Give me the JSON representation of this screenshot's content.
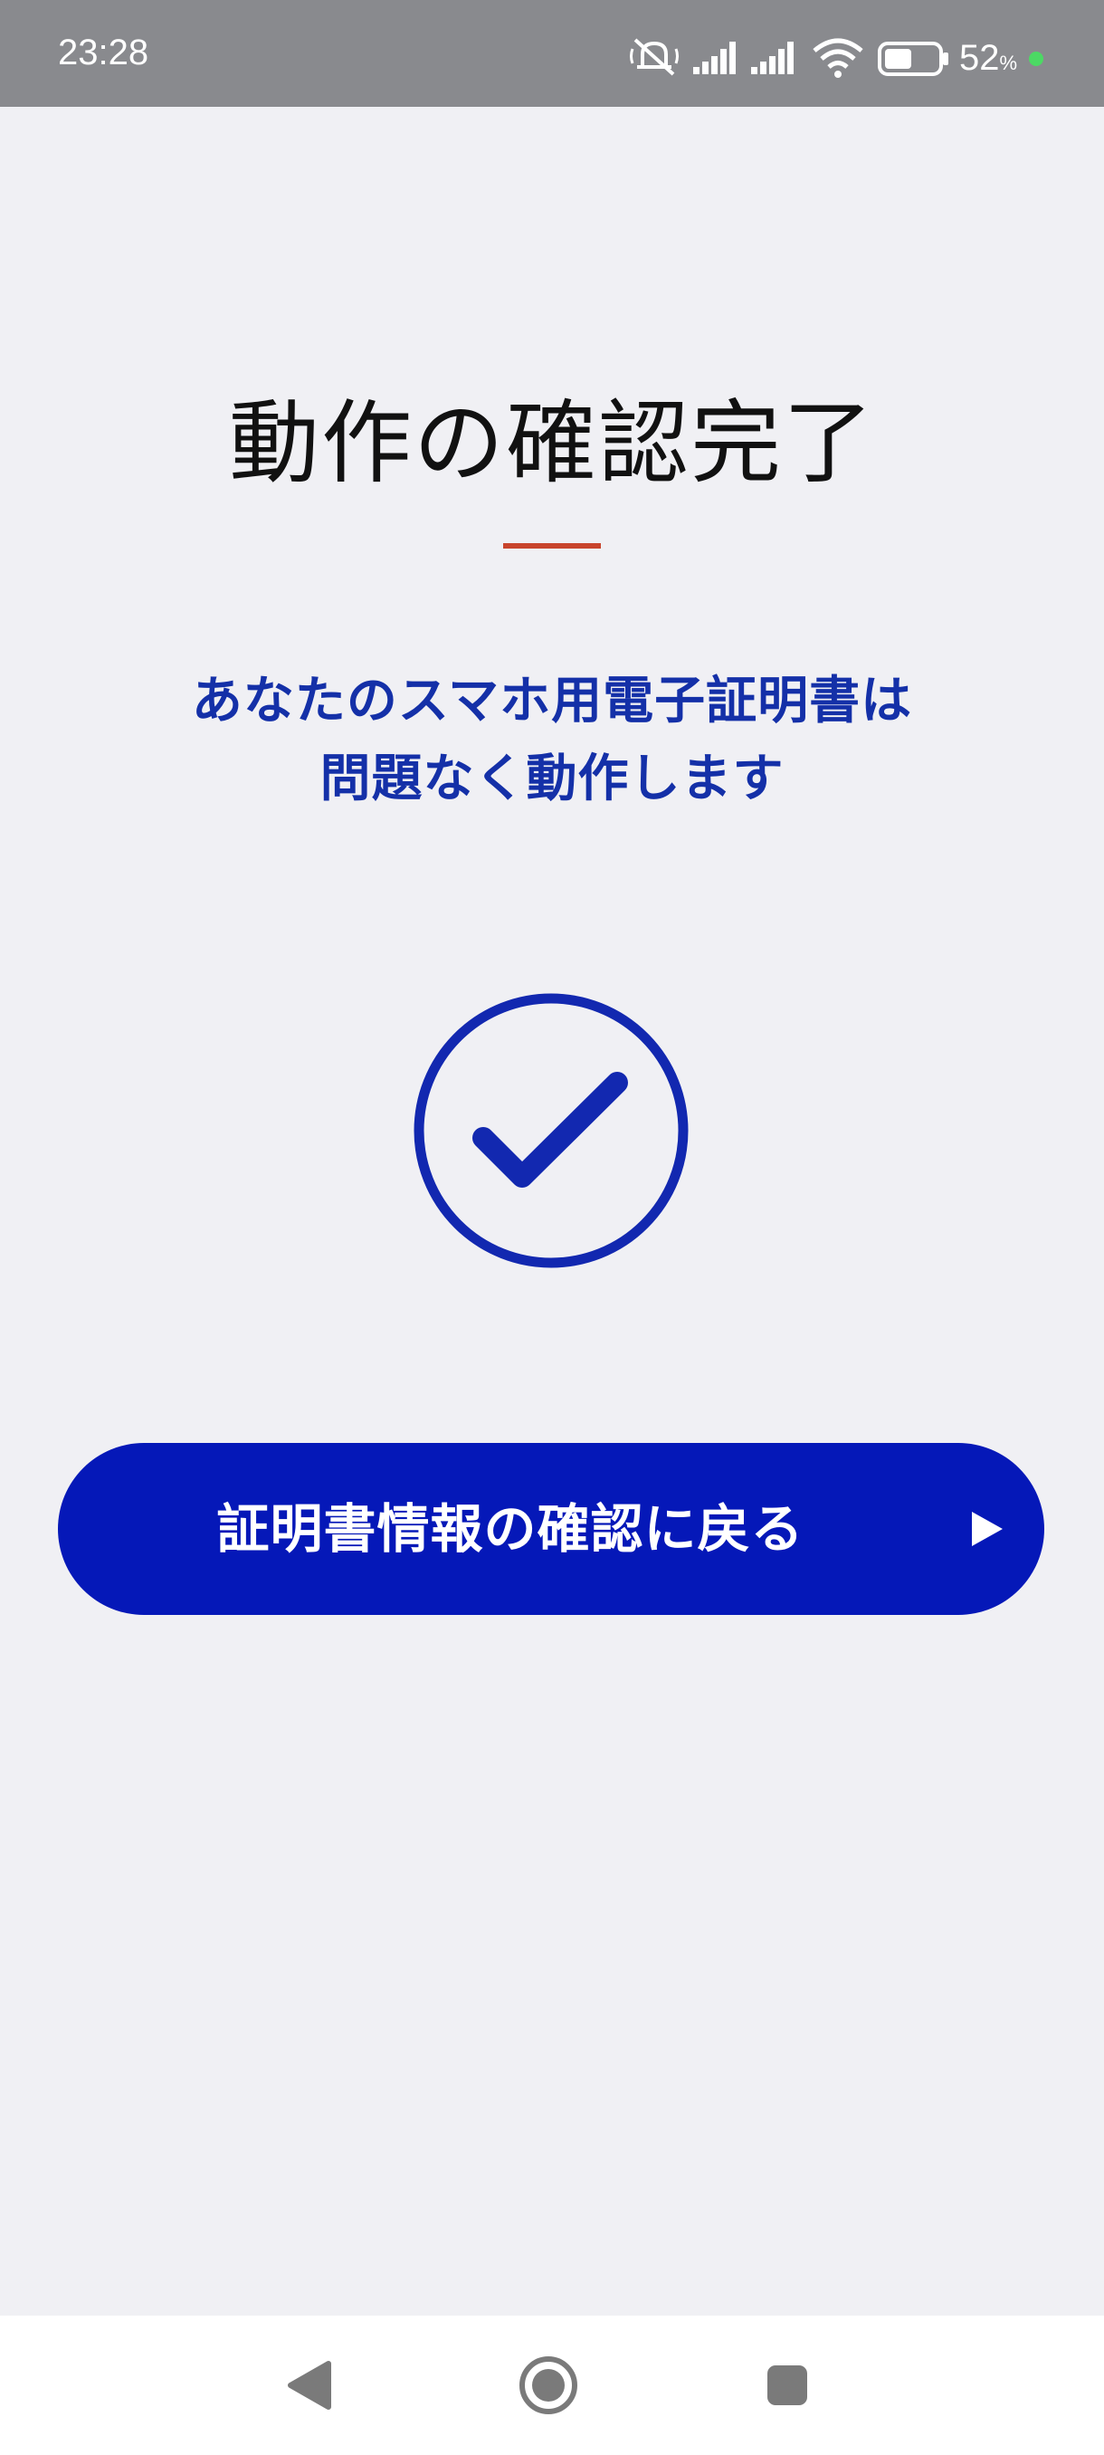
{
  "status_bar": {
    "time": "23:28",
    "battery_percent": "52",
    "battery_unit": "%",
    "icons": [
      "notifications-muted-icon",
      "signal-icon",
      "signal-icon",
      "wifi-icon",
      "battery-icon",
      "charging-dot-icon"
    ],
    "battery_level": 0.52
  },
  "main": {
    "title": "動作の確認完了",
    "message_line1": "あなたのスマホ用電子証明書は",
    "message_line2": "問題なく動作します",
    "status_icon": "check-circle-icon",
    "back_button_label": "証明書情報の確認に戻る",
    "back_button_icon": "play-arrow-icon"
  },
  "nav_bar": {
    "icons": [
      "back-triangle-icon",
      "home-circle-icon",
      "recents-square-icon"
    ]
  },
  "colors": {
    "status_bar_bg": "#898a8e",
    "page_bg": "#f0f0f4",
    "accent_underline": "#c8442c",
    "message_text": "#1430a8",
    "check_icon": "#1228b0",
    "button_bg": "#0518b8",
    "charging_dot": "#4cd964"
  }
}
